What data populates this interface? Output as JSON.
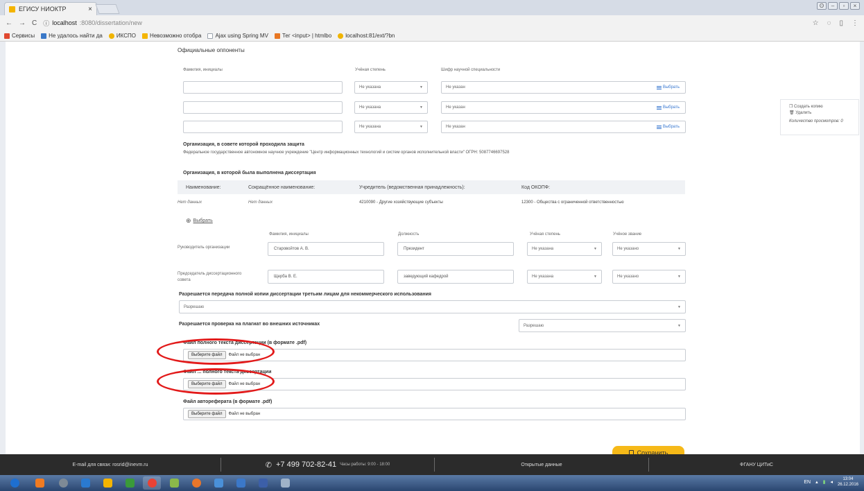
{
  "browser": {
    "tab_title": "ЕГИСУ НИОКТР",
    "url_host": "localhost",
    "url_path": ":8080/dissertation/new",
    "bookmarks": [
      {
        "label": "Сервисы",
        "color": "#e0482f"
      },
      {
        "label": "Не удалось найти да",
        "color": "#3a78c8"
      },
      {
        "label": "ИКСПО",
        "color": "#f0b400"
      },
      {
        "label": "Невозможно отобра",
        "color": "#f4b400"
      },
      {
        "label": "Ajax using Spring MV",
        "color": "#9aa3ad"
      },
      {
        "label": "Тег <input> | htmlbo",
        "color": "#e87722"
      },
      {
        "label": "localhost:81/ext/?bn",
        "color": "#f0b400"
      }
    ]
  },
  "opponents": {
    "section_title": "Официальные оппоненты",
    "col_name": "Фамилия, инициалы",
    "col_degree": "Учёная степень",
    "col_code": "Шифр научной специальности",
    "degree_value": "Не указана",
    "code_value": "Не указан",
    "pick_label": "Выбрать"
  },
  "defense_org": {
    "title": "Организация, в совете которой проходила защита",
    "value": "Федеральное государственное автономное научное учреждение \"Центр информационных технологий и систем органов исполнительной власти\" ОГРН: 5087746697528"
  },
  "org": {
    "title": "Организация, в которой была выполнена диссертация",
    "headers": [
      "Наименование:",
      "Сокращённое наименование:",
      "Учредитель (ведомственная принадлежность):",
      "Код ОКОПФ:"
    ],
    "row": [
      "Нет данных",
      "Нет данных",
      "4210090 - Другие хозяйствующие субъекты",
      "12300 - Общества с ограниченной ответственностью"
    ],
    "pick_label": "Выбрать"
  },
  "persons": {
    "col_name": "Фамилия, инициалы",
    "col_position": "Должность",
    "col_degree": "Учёная степень",
    "col_title": "Учёное звание",
    "head_label": "Руководитель организации",
    "head_name": "Старовойтов А. В.",
    "head_position": "Президент",
    "chair_label_1": "Председатель диссертационного",
    "chair_label_2": "совета",
    "chair_name": "Щерба В. Е.",
    "chair_position": "заведующий кафедрой",
    "degree_value": "Не указана",
    "title_value": "Не указано"
  },
  "permissions": {
    "copy_title": "Разрешается передача полной копии диссертации третьим лицам для некоммерческого использования",
    "copy_value": "Разрешаю",
    "plagiat_title": "Разрешается проверка на плагиат во внешних источниках",
    "plagiat_value": "Разрешаю"
  },
  "files": {
    "full_title": "Файл полного текста диссертации (в формате .pdf)",
    "second_title": "Файл ... полного текста диссертации",
    "abstract_title": "Файл автореферата (в формате .pdf)",
    "button": "Выберите файл",
    "status": "Файл не выбран"
  },
  "save_label": "Сохранить",
  "side_panel": {
    "copy": "Создать копию",
    "delete": "Удалить",
    "views": "Количество просмотров: 0"
  },
  "footer": {
    "email": "E-mail для связи: rosrid@inevm.ru",
    "phone": "+7 499 702-82-41",
    "hours": "Часы работы: 9:00 - 18:00",
    "open_data": "Открытые данные",
    "org": "ФГАНУ ЦИТиС"
  },
  "taskbar": {
    "lang": "EN",
    "time": "13:04",
    "date": "26.12.2016",
    "apps": [
      "#1e6fd0",
      "#f07b22",
      "#7e8a96",
      "#2a7ad1",
      "#f4b400",
      "#3a9a3a",
      "#e94235",
      "#8bb84a",
      "#e8762b",
      "#4a90d9",
      "#3b78c9",
      "#3c5fa8",
      "#9fb2c8"
    ]
  }
}
